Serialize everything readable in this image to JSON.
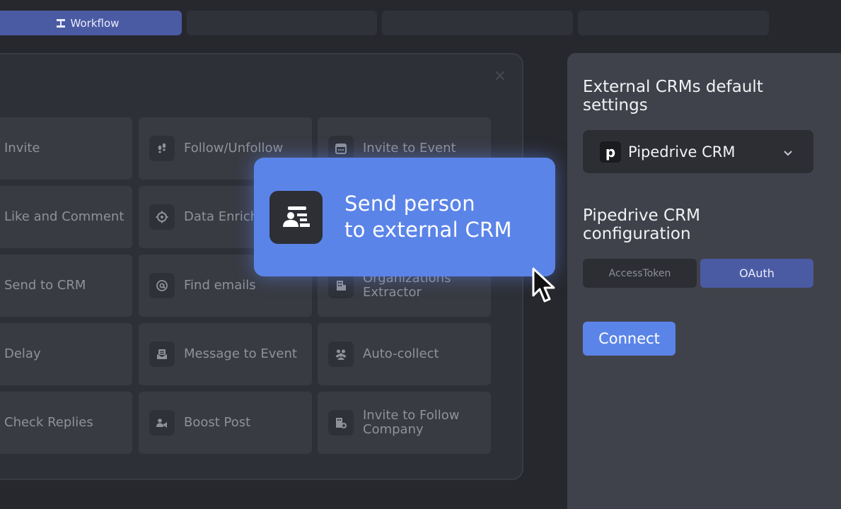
{
  "tabs": {
    "active_label": "Workflow",
    "active_icon": "workflow-icon"
  },
  "modal": {
    "close_icon": "close-icon",
    "cards": [
      {
        "label": "Invite",
        "icon": null
      },
      {
        "label": "Follow/Unfollow",
        "icon": "footsteps-icon"
      },
      {
        "label": "Invite to Event",
        "icon": "calendar-icon"
      },
      {
        "label": "Like and Comment",
        "icon": null
      },
      {
        "label": "Data Enrich",
        "icon": "target-icon"
      },
      {
        "label": "",
        "icon": null
      },
      {
        "label": "Send to CRM",
        "icon": null
      },
      {
        "label": "Find emails",
        "icon": "at-icon"
      },
      {
        "label": "Organizations Extractor",
        "icon": "building-icon"
      },
      {
        "label": "Delay",
        "icon": null
      },
      {
        "label": "Message to Event",
        "icon": "mail-icon"
      },
      {
        "label": "Auto-collect",
        "icon": "group-icon"
      },
      {
        "label": "Check Replies",
        "icon": null
      },
      {
        "label": "Boost Post",
        "icon": "boost-icon"
      },
      {
        "label": "Invite to Follow Company",
        "icon": "building-add-icon"
      }
    ]
  },
  "highlight": {
    "line1": "Send person",
    "line2": "to external CRM",
    "icon": "person-card-icon"
  },
  "panel": {
    "title1": "External CRMs default",
    "title2": "settings",
    "crm_select": "Pipedrive CRM",
    "crm_logo": "p",
    "config_title1": "Pipedrive CRM",
    "config_title2": "configuration",
    "auth_options": [
      "AccessToken",
      "OAuth"
    ],
    "auth_selected": "OAuth",
    "connect_label": "Connect"
  },
  "colors": {
    "accent": "#5b84e8",
    "active_tab": "#4b5ba3",
    "bg": "#27282e",
    "panel": "#40424b"
  }
}
